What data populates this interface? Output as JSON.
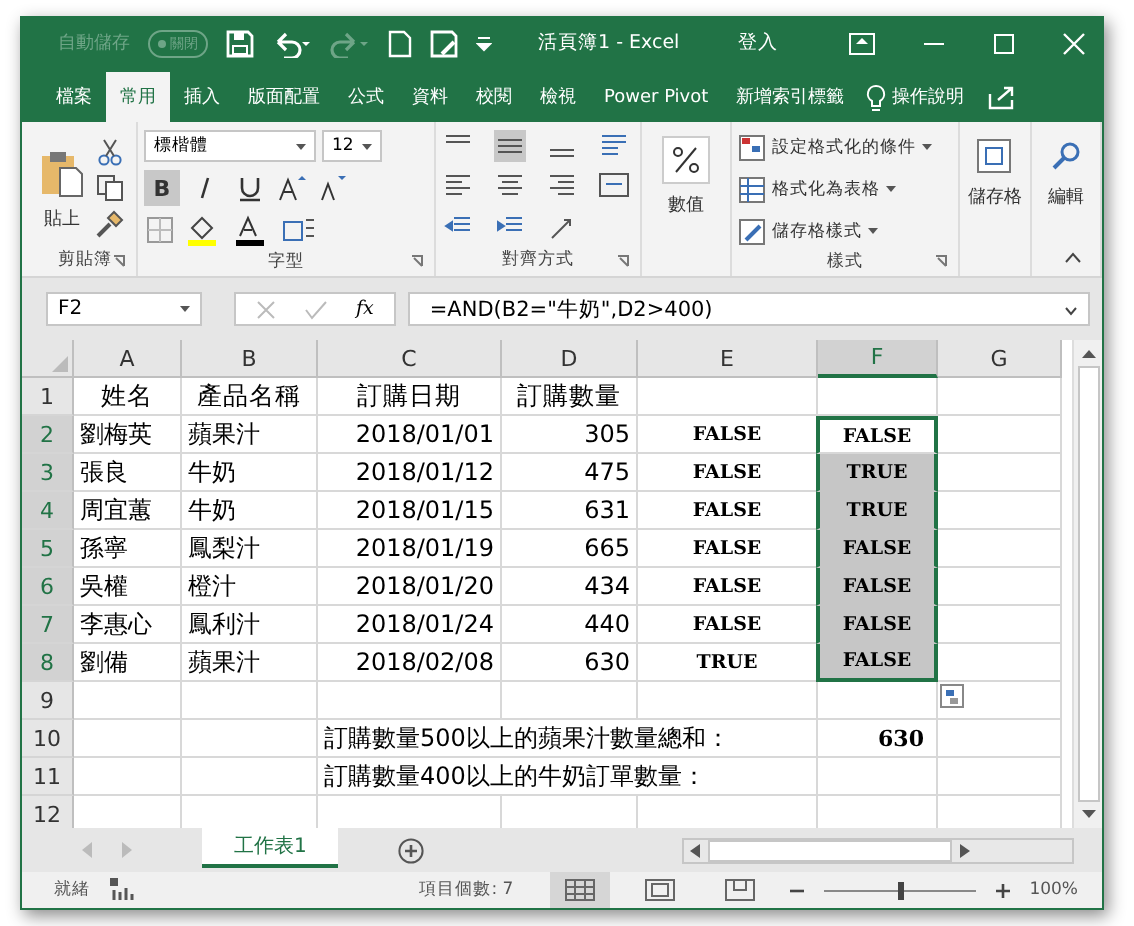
{
  "title_bar": {
    "autosave_label": "自動儲存",
    "autosave_toggle": {
      "label": "關閉",
      "on": false
    },
    "title": "活頁簿1  -  Excel",
    "sign_in": "登入"
  },
  "menu_tabs": [
    {
      "label": "檔案",
      "selected": false
    },
    {
      "label": "常用",
      "selected": true
    },
    {
      "label": "插入",
      "selected": false
    },
    {
      "label": "版面配置",
      "selected": false
    },
    {
      "label": "公式",
      "selected": false
    },
    {
      "label": "資料",
      "selected": false
    },
    {
      "label": "校閱",
      "selected": false
    },
    {
      "label": "檢視",
      "selected": false
    },
    {
      "label": "Power Pivot",
      "selected": false
    },
    {
      "label": "新增索引標籤",
      "selected": false
    }
  ],
  "tell_me": "操作說明",
  "ribbon": {
    "clipboard": {
      "paste": "貼上",
      "label": "剪貼簿"
    },
    "font": {
      "font_name": "標楷體",
      "font_size": "12",
      "bold": {
        "label": "B",
        "on": true
      },
      "label": "字型"
    },
    "alignment": {
      "label": "對齊方式"
    },
    "number": {
      "button": "數值"
    },
    "styles": {
      "items": [
        "設定格式化的條件",
        "格式化為表格",
        "儲存格樣式"
      ],
      "label": "樣式"
    },
    "cells": {
      "button": "儲存格"
    },
    "editing": {
      "button": "編輯"
    }
  },
  "formula_bar": {
    "name_box": "F2",
    "fx": "fx",
    "formula": "=AND(B2=\"牛奶\",D2>400)"
  },
  "sheet": {
    "columns": [
      {
        "label": "A",
        "selected": false
      },
      {
        "label": "B",
        "selected": false
      },
      {
        "label": "C",
        "selected": false
      },
      {
        "label": "D",
        "selected": false
      },
      {
        "label": "E",
        "selected": false
      },
      {
        "label": "F",
        "selected": true
      },
      {
        "label": "G",
        "selected": false
      }
    ],
    "rows": [
      {
        "header": "1",
        "selected": false,
        "cells": [
          {
            "text": "姓名",
            "kind": "head"
          },
          {
            "text": "產品名稱",
            "kind": "head"
          },
          {
            "text": "訂購日期",
            "kind": "head"
          },
          {
            "text": "訂購數量",
            "kind": "head"
          },
          {
            "kind": "empty"
          },
          {
            "kind": "empty"
          },
          {
            "kind": "empty"
          }
        ]
      },
      {
        "header": "2",
        "selected": true,
        "cells": [
          {
            "text": "劉梅英",
            "kind": "text"
          },
          {
            "text": "蘋果汁",
            "kind": "text"
          },
          {
            "text": "2018/01/01",
            "kind": "number"
          },
          {
            "text": "305",
            "kind": "number"
          },
          {
            "text": "FALSE",
            "kind": "bool"
          },
          {
            "text": "FALSE",
            "kind": "bool"
          },
          {
            "kind": "empty"
          }
        ]
      },
      {
        "header": "3",
        "selected": true,
        "cells": [
          {
            "text": "張良",
            "kind": "text"
          },
          {
            "text": "牛奶",
            "kind": "text"
          },
          {
            "text": "2018/01/12",
            "kind": "number"
          },
          {
            "text": "475",
            "kind": "number"
          },
          {
            "text": "FALSE",
            "kind": "bool"
          },
          {
            "text": "TRUE",
            "kind": "bool"
          },
          {
            "kind": "empty"
          }
        ]
      },
      {
        "header": "4",
        "selected": true,
        "cells": [
          {
            "text": "周宜蕙",
            "kind": "text"
          },
          {
            "text": "牛奶",
            "kind": "text"
          },
          {
            "text": "2018/01/15",
            "kind": "number"
          },
          {
            "text": "631",
            "kind": "number"
          },
          {
            "text": "FALSE",
            "kind": "bool"
          },
          {
            "text": "TRUE",
            "kind": "bool"
          },
          {
            "kind": "empty"
          }
        ]
      },
      {
        "header": "5",
        "selected": true,
        "cells": [
          {
            "text": "孫寧",
            "kind": "text"
          },
          {
            "text": "鳳梨汁",
            "kind": "text"
          },
          {
            "text": "2018/01/19",
            "kind": "number"
          },
          {
            "text": "665",
            "kind": "number"
          },
          {
            "text": "FALSE",
            "kind": "bool"
          },
          {
            "text": "FALSE",
            "kind": "bool"
          },
          {
            "kind": "empty"
          }
        ]
      },
      {
        "header": "6",
        "selected": true,
        "cells": [
          {
            "text": "吳權",
            "kind": "text"
          },
          {
            "text": "橙汁",
            "kind": "text"
          },
          {
            "text": "2018/01/20",
            "kind": "number"
          },
          {
            "text": "434",
            "kind": "number"
          },
          {
            "text": "FALSE",
            "kind": "bool"
          },
          {
            "text": "FALSE",
            "kind": "bool"
          },
          {
            "kind": "empty"
          }
        ]
      },
      {
        "header": "7",
        "selected": true,
        "cells": [
          {
            "text": "李惠心",
            "kind": "text"
          },
          {
            "text": "鳳利汁",
            "kind": "text"
          },
          {
            "text": "2018/01/24",
            "kind": "number"
          },
          {
            "text": "440",
            "kind": "number"
          },
          {
            "text": "FALSE",
            "kind": "bool"
          },
          {
            "text": "FALSE",
            "kind": "bool"
          },
          {
            "kind": "empty"
          }
        ]
      },
      {
        "header": "8",
        "selected": true,
        "cells": [
          {
            "text": "劉備",
            "kind": "text"
          },
          {
            "text": "蘋果汁",
            "kind": "text"
          },
          {
            "text": "2018/02/08",
            "kind": "number"
          },
          {
            "text": "630",
            "kind": "number"
          },
          {
            "text": "TRUE",
            "kind": "bool"
          },
          {
            "text": "FALSE",
            "kind": "bool"
          },
          {
            "kind": "empty"
          }
        ]
      },
      {
        "header": "9",
        "selected": false,
        "cells": [
          {
            "kind": "empty"
          },
          {
            "kind": "empty"
          },
          {
            "kind": "empty"
          },
          {
            "kind": "empty"
          },
          {
            "kind": "empty"
          },
          {
            "kind": "empty"
          },
          {
            "kind": "empty"
          }
        ]
      },
      {
        "header": "10",
        "selected": false,
        "cells": [
          {
            "kind": "empty"
          },
          {
            "kind": "empty"
          },
          {
            "text": "訂購數量500以上的蘋果汁數量總和：",
            "kind": "text"
          },
          {
            "kind": "empty"
          },
          {
            "kind": "empty"
          },
          {
            "text": "630",
            "kind": "total"
          },
          {
            "kind": "empty"
          }
        ]
      },
      {
        "header": "11",
        "selected": false,
        "cells": [
          {
            "kind": "empty"
          },
          {
            "kind": "empty"
          },
          {
            "text": "訂購數量400以上的牛奶訂單數量：",
            "kind": "text"
          },
          {
            "kind": "empty"
          },
          {
            "kind": "empty"
          },
          {
            "kind": "empty"
          },
          {
            "kind": "empty"
          }
        ]
      },
      {
        "header": "12",
        "selected": false,
        "cells": [
          {
            "kind": "empty"
          },
          {
            "kind": "empty"
          },
          {
            "kind": "empty"
          },
          {
            "kind": "empty"
          },
          {
            "kind": "empty"
          },
          {
            "kind": "empty"
          },
          {
            "kind": "empty"
          }
        ]
      }
    ]
  },
  "sheet_tabs": [
    {
      "label": "工作表1",
      "selected": true
    }
  ],
  "status_bar": {
    "status": "就緒",
    "count": "項目個數: 7",
    "zoom": {
      "level": 0.5,
      "reading": "100%"
    }
  }
}
